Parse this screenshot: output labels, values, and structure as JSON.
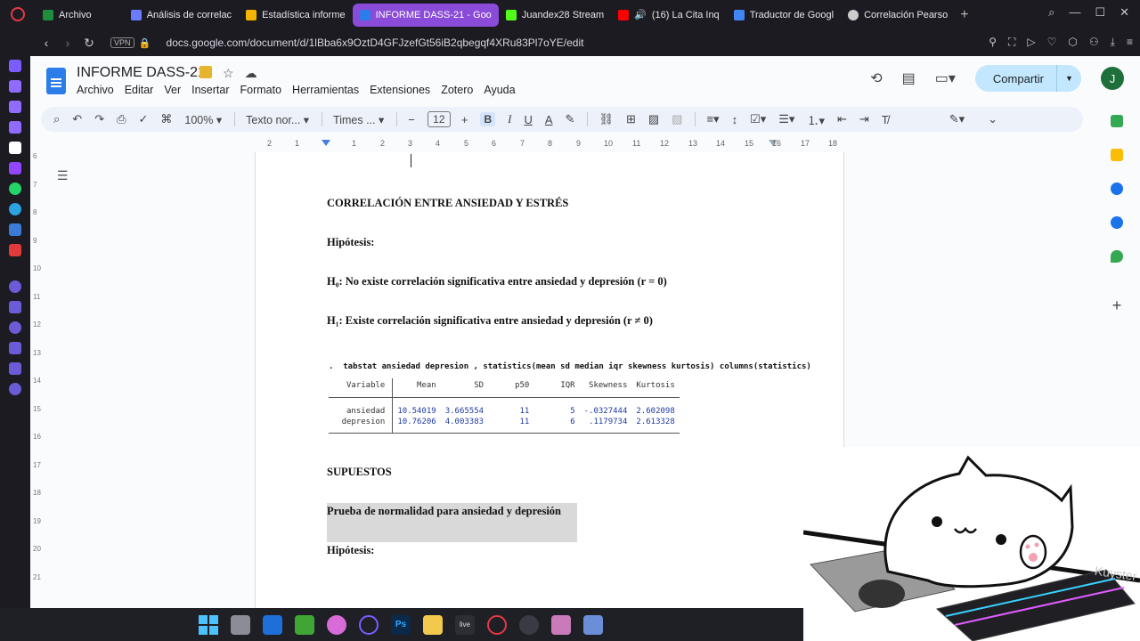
{
  "browser": {
    "tabs": [
      {
        "label": "Archivo",
        "favicon_color": "#1e8e3e"
      },
      {
        "label": "Análisis de correlac",
        "favicon_color": "#6b7cff"
      },
      {
        "label": "Estadística informe",
        "favicon_color": "#f4b400"
      },
      {
        "label": "INFORME DASS-21 - Goo",
        "favicon_color": "#2b7de9"
      },
      {
        "label": "Juandex28 Stream",
        "favicon_color": "#53fc18"
      },
      {
        "label": "(16) La Cita Inq",
        "favicon_color": "#ff0000"
      },
      {
        "label": "Traductor de Googl",
        "favicon_color": "#4285f4"
      },
      {
        "label": "Correlación Pearso",
        "favicon_color": "#cccccc"
      }
    ],
    "active_tab_index": 3,
    "vpn_label": "VPN",
    "url": "docs.google.com/document/d/1lBba6x9OztD4GFJzefGt56iB2qbegqf4XRu83Pl7oYE/edit"
  },
  "docs": {
    "title": "INFORME DASS-21",
    "menu": [
      "Archivo",
      "Editar",
      "Ver",
      "Insertar",
      "Formato",
      "Herramientas",
      "Extensiones",
      "Zotero",
      "Ayuda"
    ],
    "share_label": "Compartir",
    "avatar_initial": "J",
    "toolbar": {
      "zoom": "100%",
      "style": "Texto nor...",
      "font": "Times ...",
      "font_size": "12"
    },
    "ruler_numbers": [
      "2",
      "1",
      "1",
      "2",
      "3",
      "4",
      "5",
      "6",
      "7",
      "8",
      "9",
      "10",
      "11",
      "12",
      "13",
      "14",
      "15",
      "16",
      "17",
      "18"
    ],
    "vruler_numbers": [
      "6",
      "7",
      "8",
      "9",
      "10",
      "11",
      "12",
      "13",
      "14",
      "15",
      "16",
      "17",
      "18",
      "19",
      "20",
      "21"
    ]
  },
  "document": {
    "heading": "CORRELACIÓN ENTRE ANSIEDAD Y ESTRÉS",
    "hypothesis_label": "Hipótesis:",
    "h0": "H₀: No existe correlación significativa entre ansiedad y depresión (r = 0)",
    "h1": "H₁: Existe correlación significativa entre ansiedad y depresión (r ≠ 0)",
    "stata_command": ".  tabstat ansiedad depresion , statistics(mean sd median iqr skewness kurtosis) columns(statistics)",
    "stats_table": {
      "headers": [
        "Variable",
        "Mean",
        "SD",
        "p50",
        "IQR",
        "Skewness",
        "Kurtosis"
      ],
      "rows": [
        [
          "ansiedad",
          "10.54019",
          "3.665554",
          "11",
          "5",
          "-.0327444",
          "2.602098"
        ],
        [
          "depresion",
          "10.76206",
          "4.003383",
          "11",
          "6",
          ".1179734",
          "2.613328"
        ]
      ]
    },
    "supuestos": "SUPUESTOS",
    "normality_title": "Prueba de normalidad para ansiedad y depresión",
    "hypothesis_label_2": "Hipótesis:"
  },
  "overlay": {
    "watermark": "Kuyster"
  },
  "icons": {
    "tab_page": "page-icon",
    "nav": [
      "back-icon",
      "forward-icon",
      "reload-icon",
      "lock-icon"
    ],
    "docs_title": [
      "star-icon",
      "cloud-icon"
    ],
    "top_right": [
      "history-icon",
      "comment-icon",
      "video-call-icon"
    ]
  }
}
